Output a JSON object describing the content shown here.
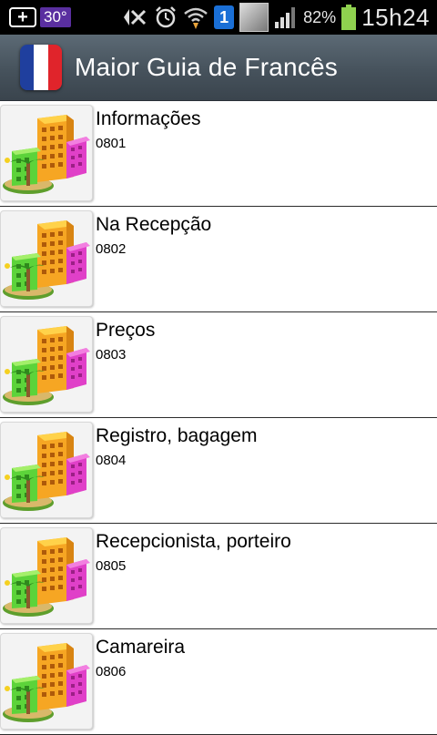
{
  "status_bar": {
    "temperature": "30°",
    "sim_label": "1",
    "battery_percent": "82%",
    "time": "15h24"
  },
  "action_bar": {
    "title": "Maior Guia de Francês",
    "flag_colors": [
      "#1f3f9e",
      "#ffffff",
      "#e0242b"
    ]
  },
  "items": [
    {
      "title": "Informações",
      "code": "0801",
      "icon": "hotel-buildings-icon"
    },
    {
      "title": "Na Recepção",
      "code": "0802",
      "icon": "hotel-buildings-icon"
    },
    {
      "title": "Preços",
      "code": "0803",
      "icon": "hotel-buildings-icon"
    },
    {
      "title": "Registro, bagagem",
      "code": "0804",
      "icon": "hotel-buildings-icon"
    },
    {
      "title": "Recepcionista, porteiro",
      "code": "0805",
      "icon": "hotel-buildings-icon"
    },
    {
      "title": "Camareira",
      "code": "0806",
      "icon": "hotel-buildings-icon"
    }
  ]
}
